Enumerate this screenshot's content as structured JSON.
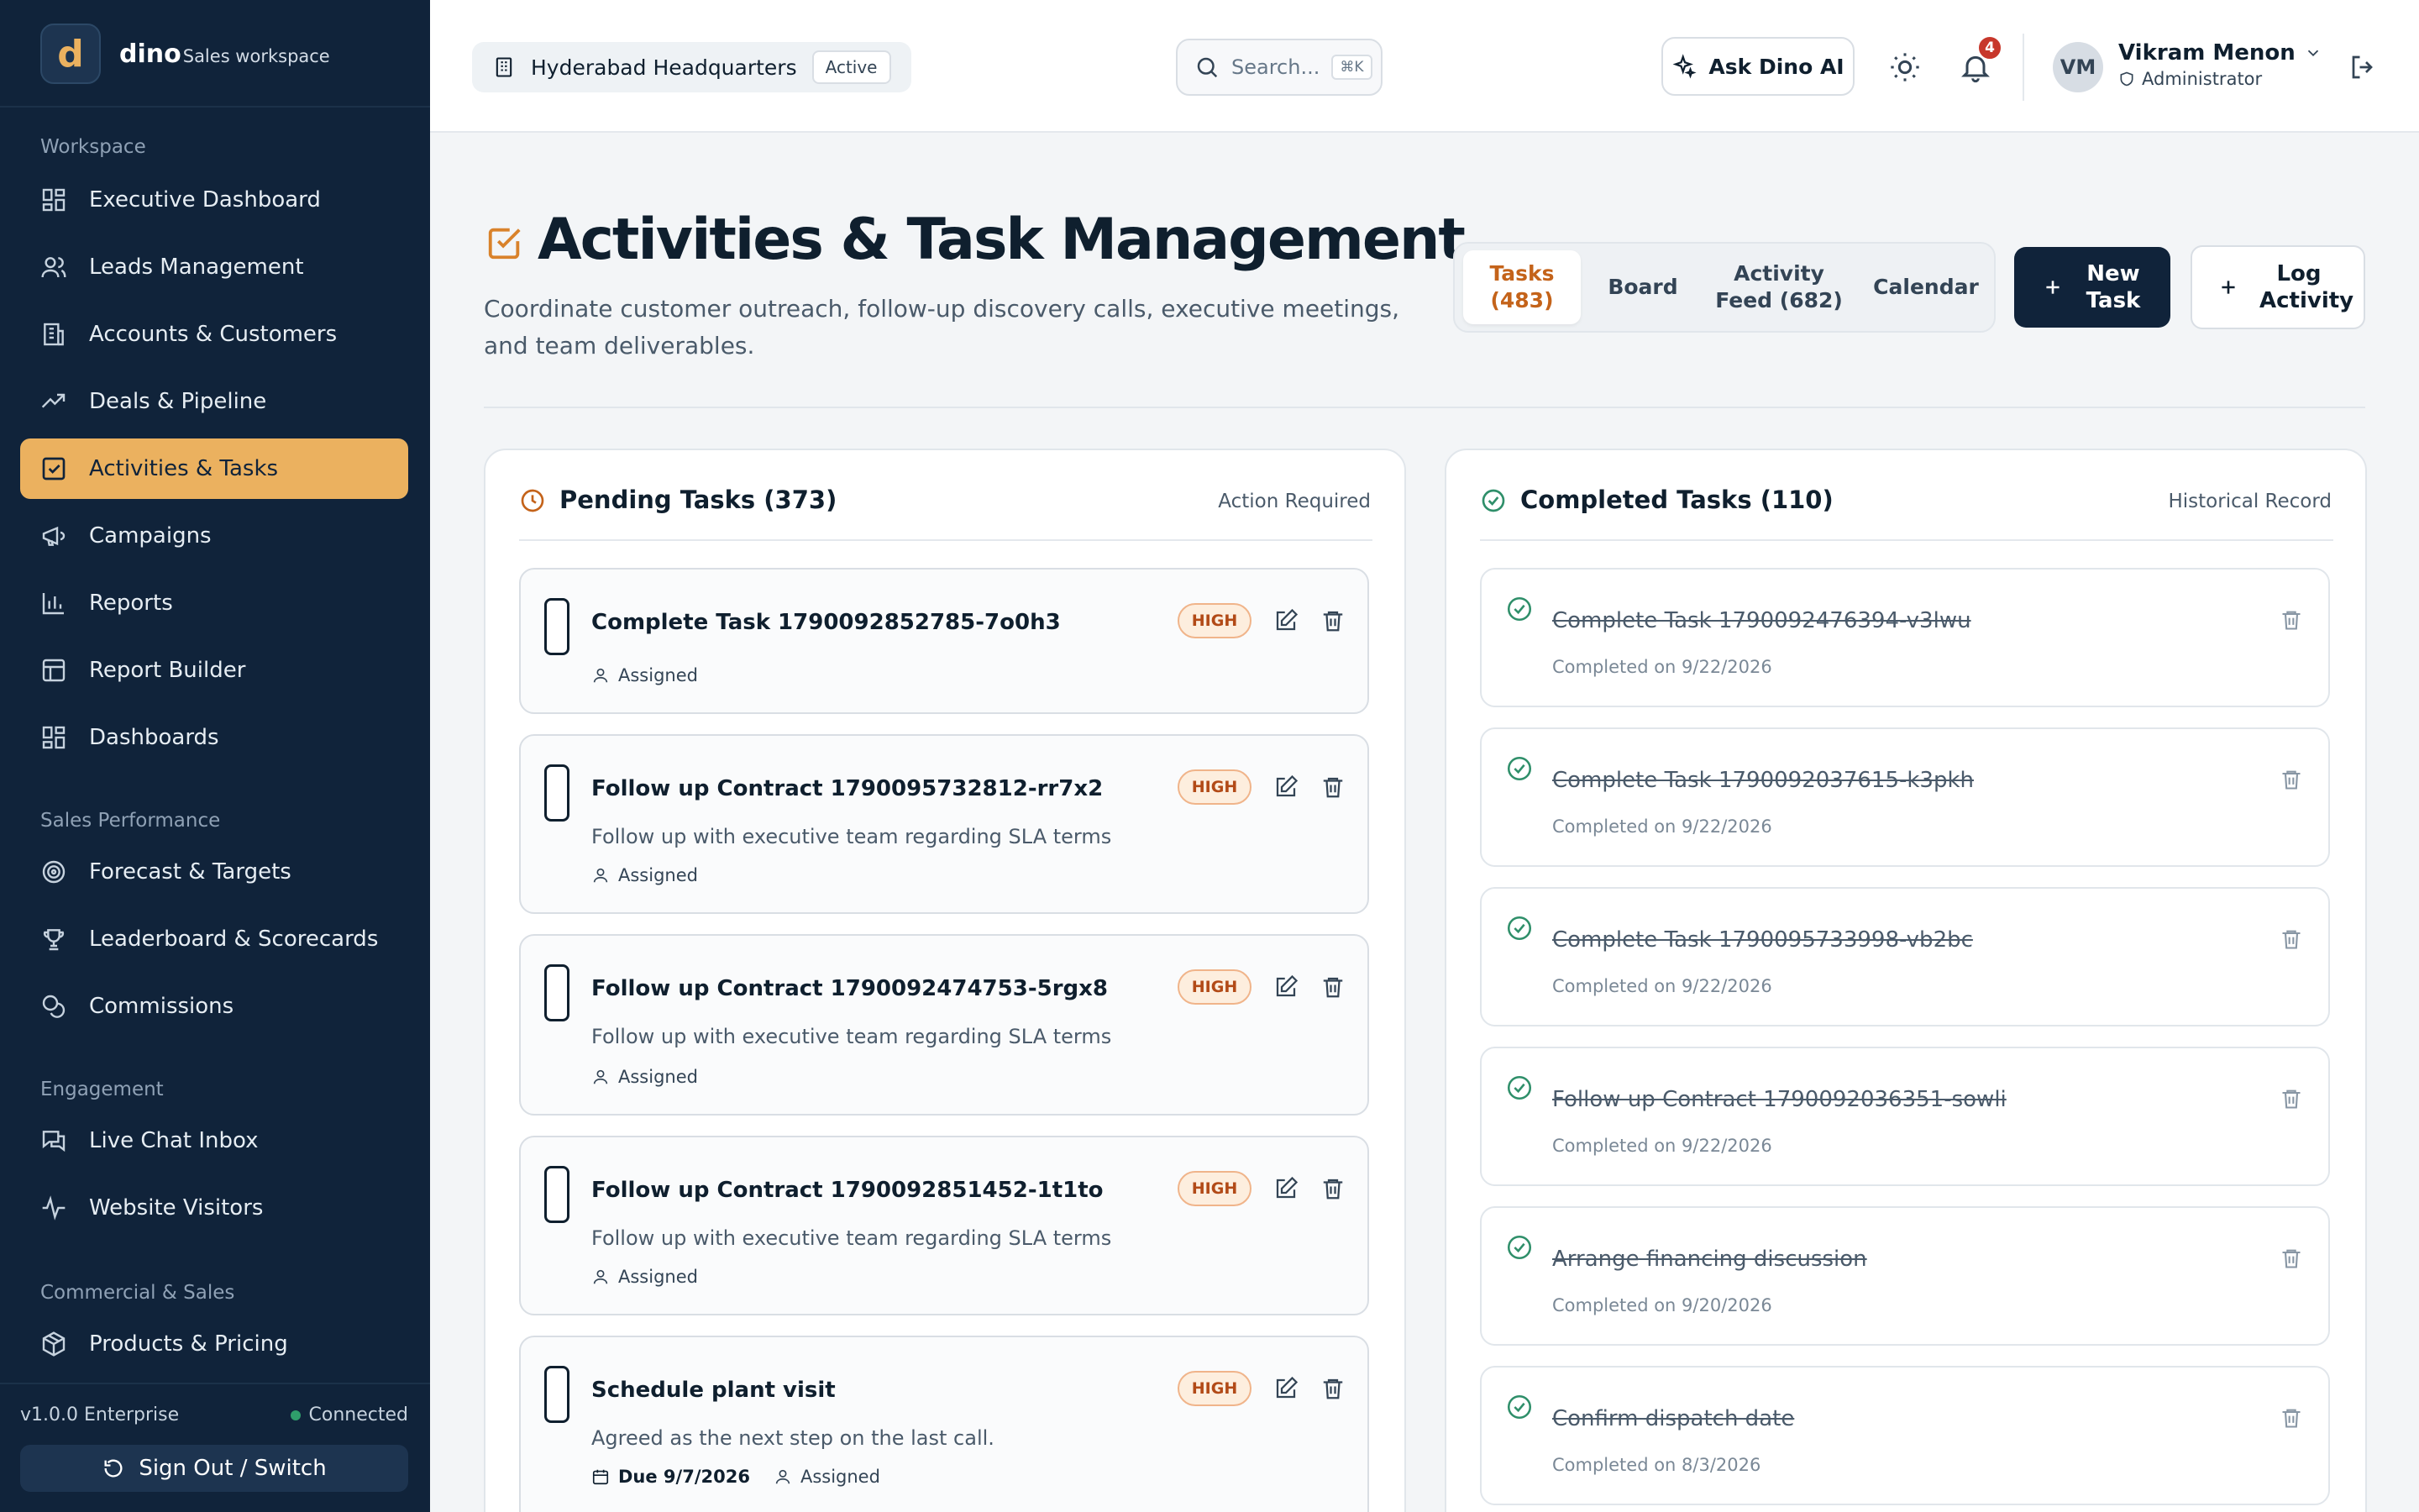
{
  "brand": {
    "logo_letter": "d",
    "name": "dino",
    "subtitle": "Sales workspace"
  },
  "sidebar": {
    "sections": [
      {
        "label": "Workspace",
        "items": [
          {
            "label": "Executive Dashboard",
            "icon": "grid-icon"
          },
          {
            "label": "Leads Management",
            "icon": "users-icon"
          },
          {
            "label": "Accounts & Customers",
            "icon": "building-icon"
          },
          {
            "label": "Deals & Pipeline",
            "icon": "trend-icon"
          },
          {
            "label": "Activities & Tasks",
            "icon": "checkbox-icon",
            "active": true
          },
          {
            "label": "Campaigns",
            "icon": "megaphone-icon"
          },
          {
            "label": "Reports",
            "icon": "bar-chart-icon"
          },
          {
            "label": "Report Builder",
            "icon": "table-icon"
          },
          {
            "label": "Dashboards",
            "icon": "grid-icon"
          }
        ]
      },
      {
        "label": "Sales Performance",
        "items": [
          {
            "label": "Forecast & Targets",
            "icon": "target-icon"
          },
          {
            "label": "Leaderboard & Scorecards",
            "icon": "trophy-icon"
          },
          {
            "label": "Commissions",
            "icon": "coins-icon"
          }
        ]
      },
      {
        "label": "Engagement",
        "items": [
          {
            "label": "Live Chat Inbox",
            "icon": "chat-icon"
          },
          {
            "label": "Website Visitors",
            "icon": "pulse-icon"
          }
        ]
      },
      {
        "label": "Commercial & Sales",
        "items": [
          {
            "label": "Products & Pricing",
            "icon": "package-icon"
          }
        ]
      }
    ],
    "version": "v1.0.0 Enterprise",
    "status": "Connected",
    "signout_label": "Sign Out / Switch"
  },
  "topbar": {
    "location": "Hyderabad Headquarters",
    "location_badge": "Active",
    "search_placeholder": "Search...",
    "search_shortcut": "⌘K",
    "ask_ai_label": "Ask Dino AI",
    "notification_count": "4",
    "user": {
      "initials": "VM",
      "name": "Vikram Menon",
      "role": "Administrator"
    }
  },
  "page": {
    "title": "Activities & Task Management",
    "subtitle": "Coordinate customer outreach, follow-up discovery calls, executive meetings, and team deliverables.",
    "view_tabs": [
      {
        "label": "Tasks (483)",
        "active": true
      },
      {
        "label": "Board"
      },
      {
        "label": "Activity Feed (682)"
      },
      {
        "label": "Calendar"
      }
    ],
    "new_task_label": "New Task",
    "log_activity_label": "Log Activity"
  },
  "pending": {
    "title": "Pending Tasks (373)",
    "meta": "Action Required",
    "tasks": [
      {
        "title": "Complete Task 1790092852785-7o0h3",
        "description": "",
        "due": "",
        "assignee": "Assigned",
        "priority": "HIGH"
      },
      {
        "title": "Follow up Contract 1790095732812-rr7x2",
        "description": "Follow up with executive team regarding SLA terms",
        "due": "",
        "assignee": "Assigned",
        "priority": "HIGH"
      },
      {
        "title": "Follow up Contract 1790092474753-5rgx8",
        "description": "Follow up with executive team regarding SLA terms",
        "due": "",
        "assignee": "Assigned",
        "priority": "HIGH"
      },
      {
        "title": "Follow up Contract 1790092851452-1t1to",
        "description": "Follow up with executive team regarding SLA terms",
        "due": "",
        "assignee": "Assigned",
        "priority": "HIGH"
      },
      {
        "title": "Schedule plant visit",
        "description": "Agreed as the next step on the last call.",
        "due": "Due 9/7/2026",
        "assignee": "Assigned",
        "priority": "HIGH"
      }
    ]
  },
  "completed": {
    "title": "Completed Tasks (110)",
    "meta": "Historical Record",
    "tasks": [
      {
        "title": "Complete Task 1790092476394-v3lwu",
        "completed": "Completed on 9/22/2026"
      },
      {
        "title": "Complete Task 1790092037615-k3pkh",
        "completed": "Completed on 9/22/2026"
      },
      {
        "title": "Complete Task 1790095733998-vb2bc",
        "completed": "Completed on 9/22/2026"
      },
      {
        "title": "Follow up Contract 1790092036351-sowli",
        "completed": "Completed on 9/22/2026"
      },
      {
        "title": "Arrange financing discussion",
        "completed": "Completed on 9/20/2026"
      },
      {
        "title": "Confirm dispatch date",
        "completed": "Completed on 8/3/2026"
      }
    ]
  },
  "colors": {
    "sidebar_bg": "#10233a",
    "accent": "#ebb15f",
    "priority_high": "#b24a17",
    "success": "#2f8f6a"
  }
}
